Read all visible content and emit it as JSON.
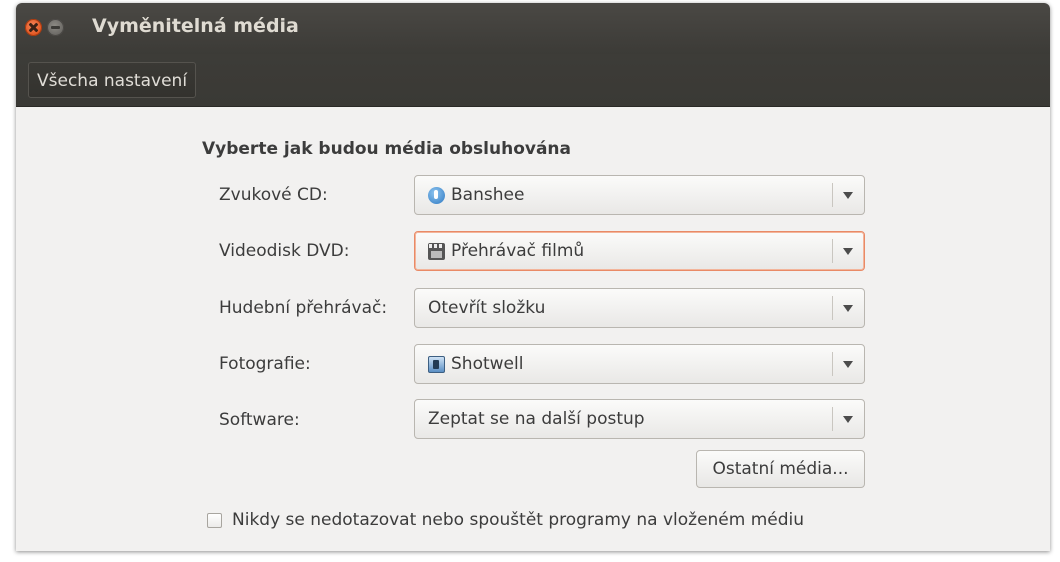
{
  "window": {
    "title": "Vyměnitelná média"
  },
  "toolbar": {
    "all_settings_label": "Všecha nastavení"
  },
  "section": {
    "heading": "Vyberte jak budou média obsluhována"
  },
  "rows": [
    {
      "label": "Zvukové CD:",
      "value": "Banshee",
      "icon": "banshee-icon",
      "focused": false
    },
    {
      "label": "Videodisk DVD:",
      "value": "Přehrávač filmů",
      "icon": "movie-player-icon",
      "focused": true
    },
    {
      "label": "Hudební přehrávač:",
      "value": "Otevřít složku",
      "icon": "",
      "focused": false
    },
    {
      "label": "Fotografie:",
      "value": "Shotwell",
      "icon": "shotwell-icon",
      "focused": false
    },
    {
      "label": "Software:",
      "value": "Zeptat se na další postup",
      "icon": "",
      "focused": false
    }
  ],
  "other_media_button": "Ostatní média...",
  "never_prompt": {
    "label": "Nikdy se nedotazovat nebo spouštět programy na vloženém médiu",
    "checked": false
  },
  "colors": {
    "titlebar": "#3c3b37",
    "focus_border": "#e98a66",
    "close_button": "#e0541e"
  }
}
